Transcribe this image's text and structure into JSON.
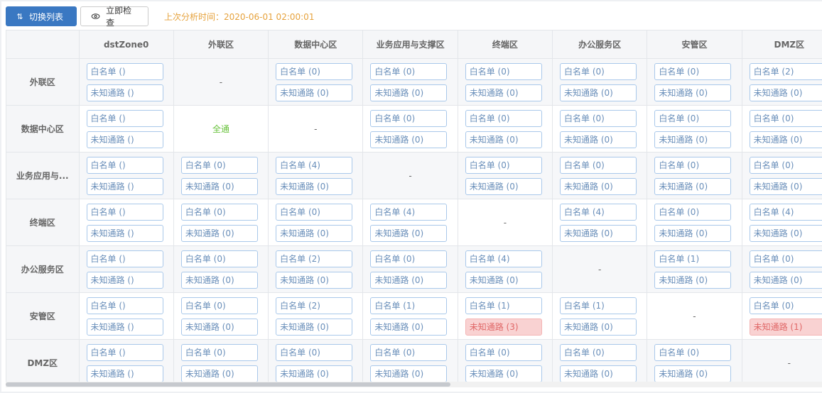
{
  "toolbar": {
    "switch_label": "切换列表",
    "check_label": "立即检查",
    "last_time": "上次分析时间：2020-06-01 02:00:01"
  },
  "columns": [
    "dstZone0",
    "外联区",
    "数据中心区",
    "业务应用与支撑区",
    "终端区",
    "办公服务区",
    "安管区",
    "DMZ区"
  ],
  "rows": [
    {
      "label": "外联区",
      "cells": [
        {
          "w": "白名单 ()",
          "u": "未知通路 ()"
        },
        {
          "dash": "-"
        },
        {
          "w": "白名单 (0)",
          "u": "未知通路 (0)"
        },
        {
          "w": "白名单 (0)",
          "u": "未知通路 (0)"
        },
        {
          "w": "白名单 (0)",
          "u": "未知通路 (0)"
        },
        {
          "w": "白名单 (0)",
          "u": "未知通路 (0)"
        },
        {
          "w": "白名单 (0)",
          "u": "未知通路 (0)"
        },
        {
          "w": "白名单 (2)",
          "u": "未知通路 (0)"
        }
      ]
    },
    {
      "label": "数据中心区",
      "cells": [
        {
          "w": "白名单 ()",
          "u": "未知通路 ()"
        },
        {
          "full": "全通"
        },
        {
          "dash": "-"
        },
        {
          "w": "白名单 (0)",
          "u": "未知通路 (0)"
        },
        {
          "w": "白名单 (0)",
          "u": "未知通路 (0)"
        },
        {
          "w": "白名单 (0)",
          "u": "未知通路 (0)"
        },
        {
          "w": "白名单 (0)",
          "u": "未知通路 (0)"
        },
        {
          "w": "白名单 (0)",
          "u": "未知通路 (0)"
        }
      ]
    },
    {
      "label": "业务应用与...",
      "cells": [
        {
          "w": "白名单 ()",
          "u": "未知通路 ()"
        },
        {
          "w": "白名单 (0)",
          "u": "未知通路 (0)"
        },
        {
          "w": "白名单 (4)",
          "u": "未知通路 (0)"
        },
        {
          "dash": "-"
        },
        {
          "w": "白名单 (0)",
          "u": "未知通路 (0)"
        },
        {
          "w": "白名单 (0)",
          "u": "未知通路 (0)"
        },
        {
          "w": "白名单 (0)",
          "u": "未知通路 (0)"
        },
        {
          "w": "白名单 (0)",
          "u": "未知通路 (0)"
        }
      ]
    },
    {
      "label": "终端区",
      "cells": [
        {
          "w": "白名单 ()",
          "u": "未知通路 ()"
        },
        {
          "w": "白名单 (0)",
          "u": "未知通路 (0)"
        },
        {
          "w": "白名单 (0)",
          "u": "未知通路 (0)"
        },
        {
          "w": "白名单 (4)",
          "u": "未知通路 (0)"
        },
        {
          "dash": "-"
        },
        {
          "w": "白名单 (4)",
          "u": "未知通路 (0)"
        },
        {
          "w": "白名单 (0)",
          "u": "未知通路 (0)"
        },
        {
          "w": "白名单 (4)",
          "u": "未知通路 (0)"
        }
      ]
    },
    {
      "label": "办公服务区",
      "cells": [
        {
          "w": "白名单 ()",
          "u": "未知通路 ()"
        },
        {
          "w": "白名单 (0)",
          "u": "未知通路 (0)"
        },
        {
          "w": "白名单 (2)",
          "u": "未知通路 (0)"
        },
        {
          "w": "白名单 (0)",
          "u": "未知通路 (0)"
        },
        {
          "w": "白名单 (4)",
          "u": "未知通路 (0)"
        },
        {
          "dash": "-"
        },
        {
          "w": "白名单 (1)",
          "u": "未知通路 (0)"
        },
        {
          "w": "白名单 (0)",
          "u": "未知通路 (0)"
        }
      ]
    },
    {
      "label": "安管区",
      "cells": [
        {
          "w": "白名单 ()",
          "u": "未知通路 ()"
        },
        {
          "w": "白名单 (0)",
          "u": "未知通路 (0)"
        },
        {
          "w": "白名单 (2)",
          "u": "未知通路 (0)"
        },
        {
          "w": "白名单 (1)",
          "u": "未知通路 (0)"
        },
        {
          "w": "白名单 (1)",
          "u": "未知通路 (3)",
          "alert": true
        },
        {
          "w": "白名单 (1)",
          "u": "未知通路 (0)"
        },
        {
          "dash": "-"
        },
        {
          "w": "白名单 (0)",
          "u": "未知通路 (1)",
          "alert": true
        }
      ]
    },
    {
      "label": "DMZ区",
      "cells": [
        {
          "w": "白名单 ()",
          "u": "未知通路 ()"
        },
        {
          "w": "白名单 (0)",
          "u": "未知通路 (0)"
        },
        {
          "w": "白名单 (0)",
          "u": "未知通路 (0)"
        },
        {
          "w": "白名单 (0)",
          "u": "未知通路 (0)"
        },
        {
          "w": "白名单 (0)",
          "u": "未知通路 (0)"
        },
        {
          "w": "白名单 (0)",
          "u": "未知通路 (0)"
        },
        {
          "w": "白名单 (0)",
          "u": "未知通路 (0)"
        },
        {
          "dash": "-"
        }
      ]
    }
  ],
  "scrollbar": {
    "position": 0
  }
}
